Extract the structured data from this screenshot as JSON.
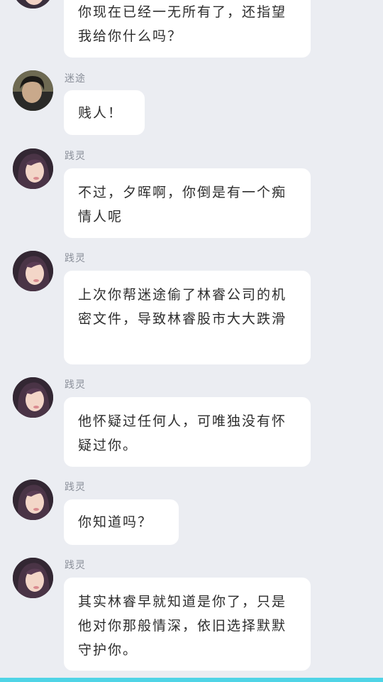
{
  "messages": [
    {
      "name": "",
      "text": "你现在已经一无所有了，还指望我给你什么吗？",
      "avatar": "woman-avatar"
    },
    {
      "name": "迷途",
      "text": "贱人！",
      "avatar": "boy-avatar"
    },
    {
      "name": "践灵",
      "text": "不过，夕晖啊，你倒是有一个痴情人呢",
      "avatar": "woman-avatar"
    },
    {
      "name": "践灵",
      "text": "上次你帮迷途偷了林睿公司的机密文件，导致林睿股市大大跌滑",
      "avatar": "woman-avatar"
    },
    {
      "name": "践灵",
      "text": "他怀疑过任何人，可唯独没有怀疑过你。",
      "avatar": "woman-avatar"
    },
    {
      "name": "践灵",
      "text": "你知道吗？",
      "avatar": "woman-avatar"
    },
    {
      "name": "践灵",
      "text": "其实林睿早就知道是你了，只是他对你那般情深，依旧选择默默守护你。",
      "avatar": "woman-avatar"
    }
  ],
  "colors": {
    "background": "#ebedf2",
    "bubble": "#ffffff",
    "accent": "#4fd4e6"
  }
}
